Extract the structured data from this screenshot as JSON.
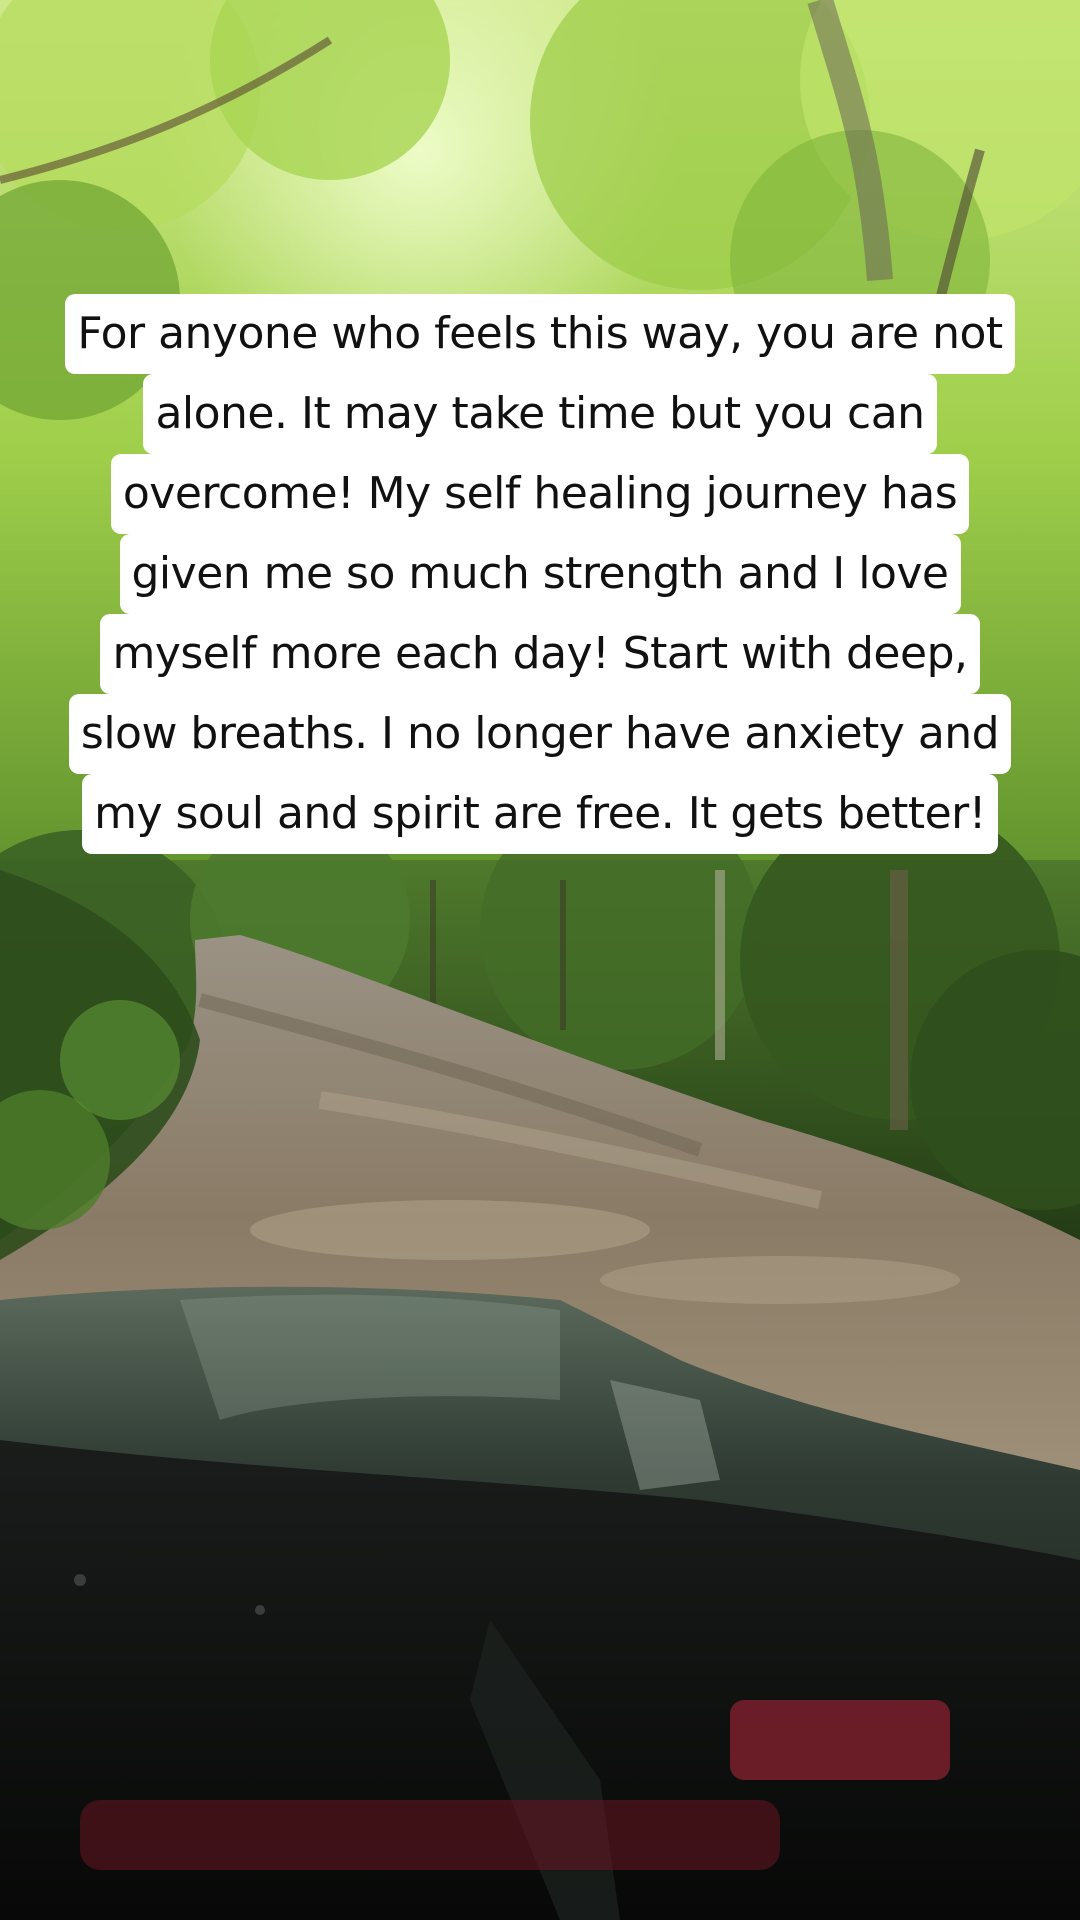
{
  "caption": {
    "lines": [
      "For anyone who feels this way, you are not",
      "alone.  It may take time but you can",
      "overcome!  My self healing journey has",
      "given me so much strength and I love",
      "myself more each day!  Start with deep,",
      "slow breaths.  I no longer have anxiety and",
      "my soul and spirit are free.  It gets better!"
    ],
    "text_color": "#111111",
    "box_color": "#ffffff"
  },
  "scene": {
    "description_colors": {
      "canopy": "#8fc23e",
      "forest": "#2f4a1f",
      "dirt_road": "#8a7b66",
      "vehicle_hood": "#1f2622",
      "dashboard": "#0d0e0c",
      "accent_red": "#8a2230"
    }
  }
}
